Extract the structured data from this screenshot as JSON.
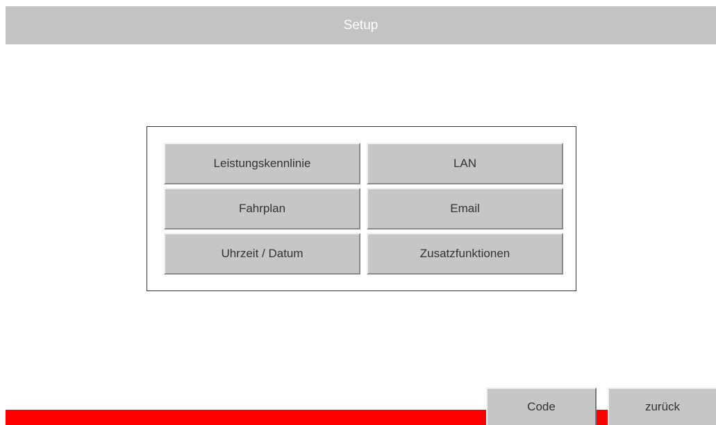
{
  "header": {
    "title": "Setup"
  },
  "menu": {
    "items": [
      {
        "label": "Leistungskennlinie"
      },
      {
        "label": "LAN"
      },
      {
        "label": "Fahrplan"
      },
      {
        "label": "Email"
      },
      {
        "label": "Uhrzeit / Datum"
      },
      {
        "label": "Zusatzfunktionen"
      }
    ]
  },
  "footer": {
    "code_label": "Code",
    "back_label": "zurück"
  },
  "colors": {
    "title_bar": "#c3c3c3",
    "button_face": "#c6c6c6",
    "status_bar": "#ff0000"
  }
}
